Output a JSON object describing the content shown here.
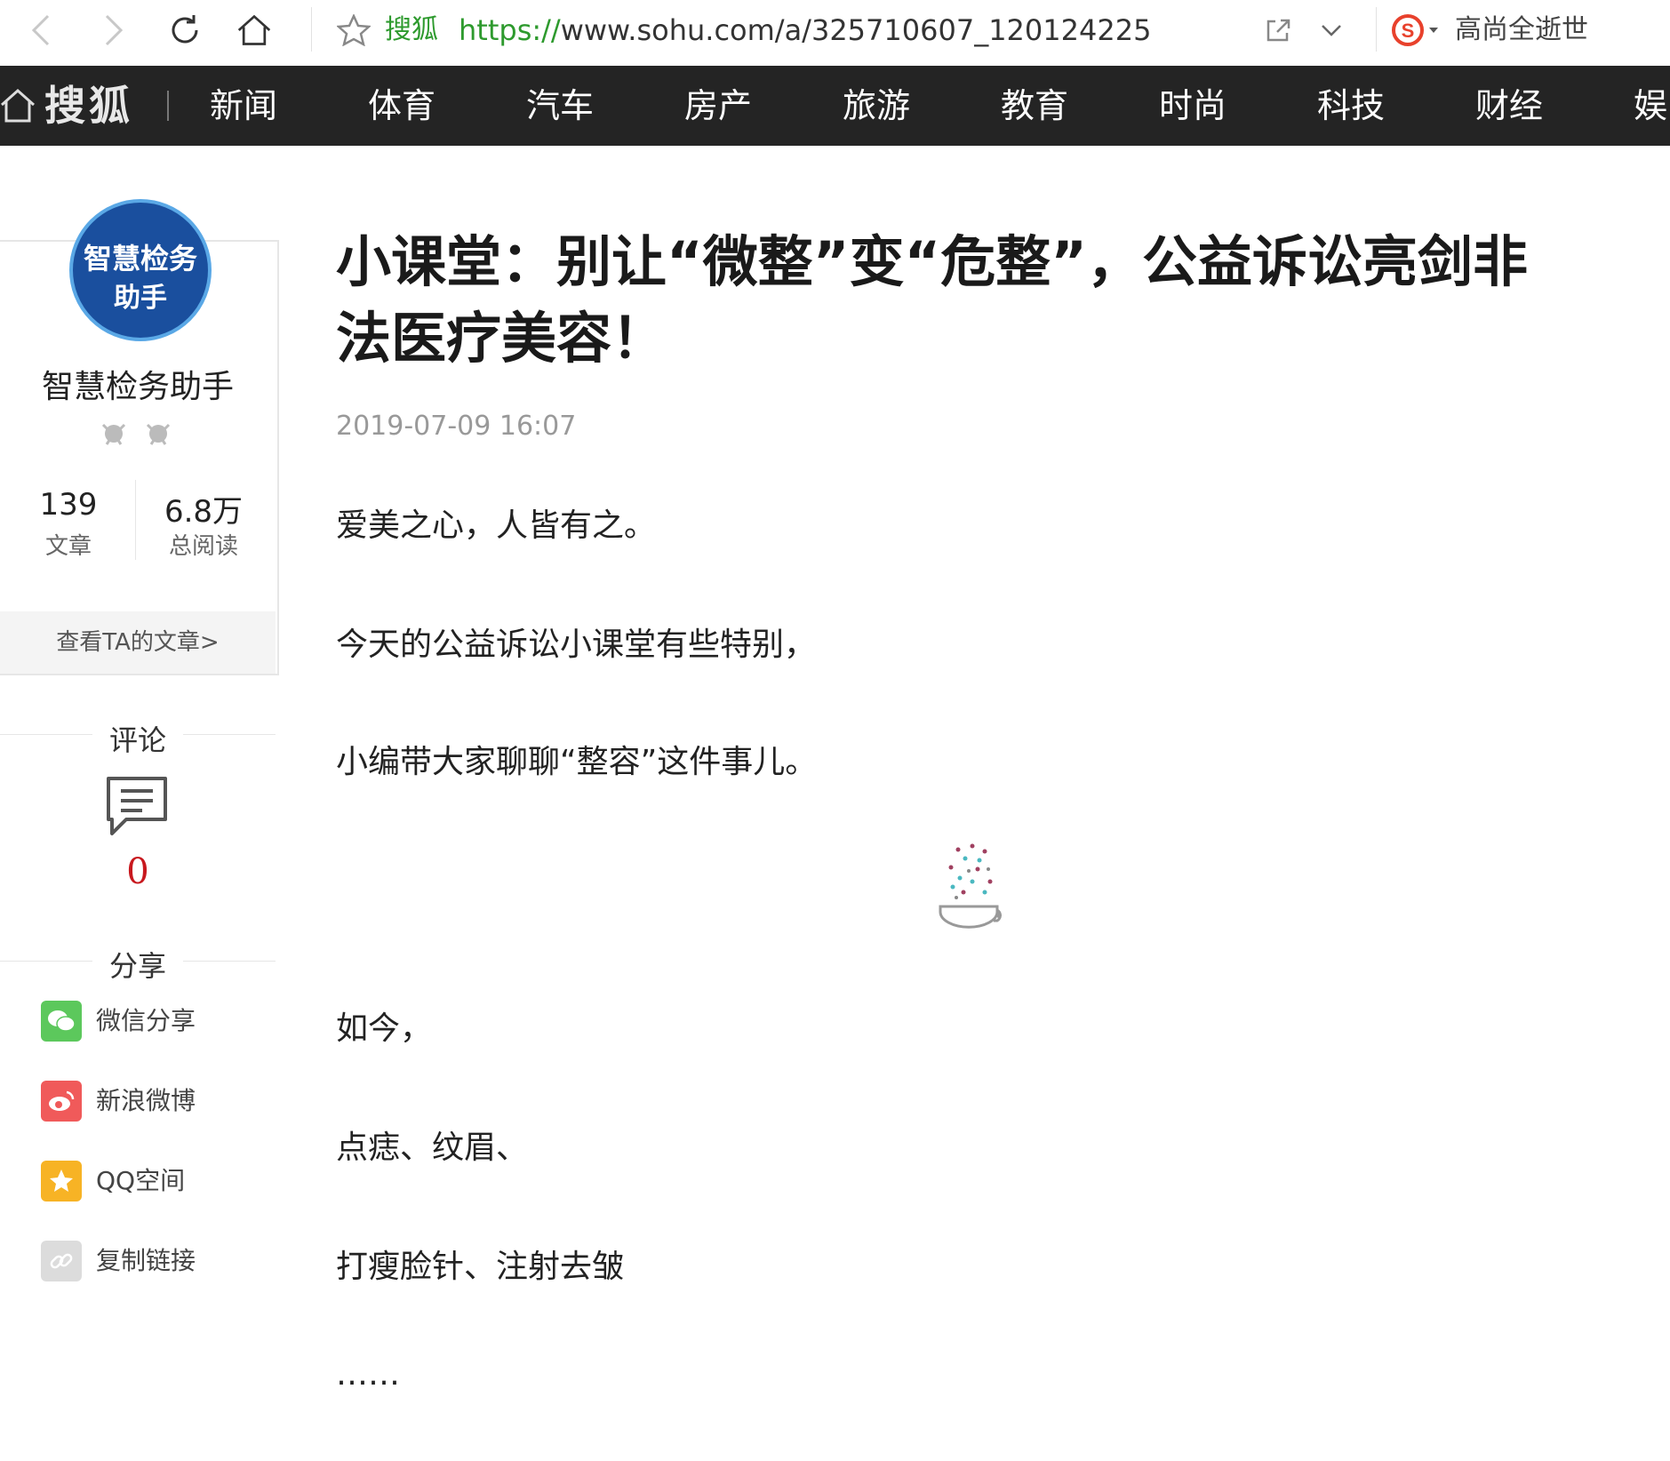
{
  "browser": {
    "site_name": "搜狐",
    "url_scheme": "https://",
    "url_rest": "www.sohu.com/a/325710607_120124225",
    "search_hint": "高尚全逝世"
  },
  "nav": {
    "logo": "搜狐",
    "items": [
      "新闻",
      "体育",
      "汽车",
      "房产",
      "旅游",
      "教育",
      "时尚",
      "科技",
      "财经",
      "娱"
    ]
  },
  "author": {
    "avatar_line1": "智慧检务",
    "avatar_line2": "助手",
    "name": "智慧检务助手",
    "articles_count": "139",
    "articles_label": "文章",
    "reads_count": "6.8万",
    "reads_label": "总阅读",
    "view_link": "查看TA的文章>"
  },
  "comments": {
    "title": "评论",
    "count": "0"
  },
  "share": {
    "title": "分享",
    "items": [
      {
        "label": "微信分享",
        "icon": "wechat-icon",
        "color": "#5cc85c"
      },
      {
        "label": "新浪微博",
        "icon": "weibo-icon",
        "color": "#f05a5a"
      },
      {
        "label": "QQ空间",
        "icon": "qzone-icon",
        "color": "#f7b325"
      },
      {
        "label": "复制链接",
        "icon": "link-icon",
        "color": "#dcdcdc"
      }
    ]
  },
  "article": {
    "title": "小课堂：别让“微整”变“危整”，公益诉讼亮剑非法医疗美容！",
    "date": "2019-07-09 16:07",
    "paragraphs": [
      "爱美之心，人皆有之。",
      "今天的公益诉讼小课堂有些特别，",
      "小编带大家聊聊“整容”这件事儿。",
      "如今，",
      "点痣、纹眉、",
      "打瘦脸针、注射去皱",
      "……"
    ]
  },
  "colors": {
    "nav_bg": "#242424",
    "accent_green": "#2e9a2e",
    "comment_red": "#c8181e"
  }
}
